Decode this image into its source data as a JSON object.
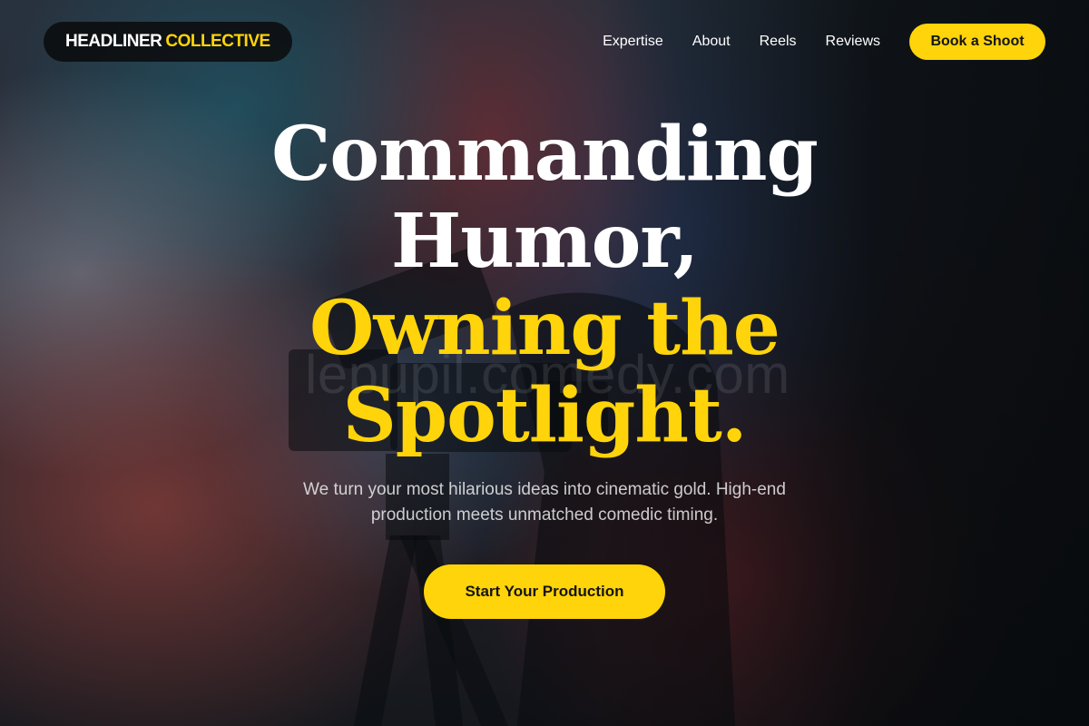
{
  "brand": {
    "name_part1": "HEADLINER",
    "name_part2": "COLLECTIVE"
  },
  "nav": {
    "links": [
      "Expertise",
      "About",
      "Reels",
      "Reviews"
    ],
    "cta_label": "Book a Shoot"
  },
  "hero": {
    "headline_white": [
      "Commanding",
      "Humor,"
    ],
    "headline_yellow": [
      "Owning the",
      "Spotlight."
    ],
    "subtext": "We turn your most hilarious ideas into cinematic gold. High-end production meets unmatched comedic timing.",
    "cta_label": "Start Your Production",
    "watermark": "lepupil.comedy.com"
  },
  "colors": {
    "accent": "#ffd40a",
    "dark": "#0f1116",
    "text": "#ffffff"
  }
}
